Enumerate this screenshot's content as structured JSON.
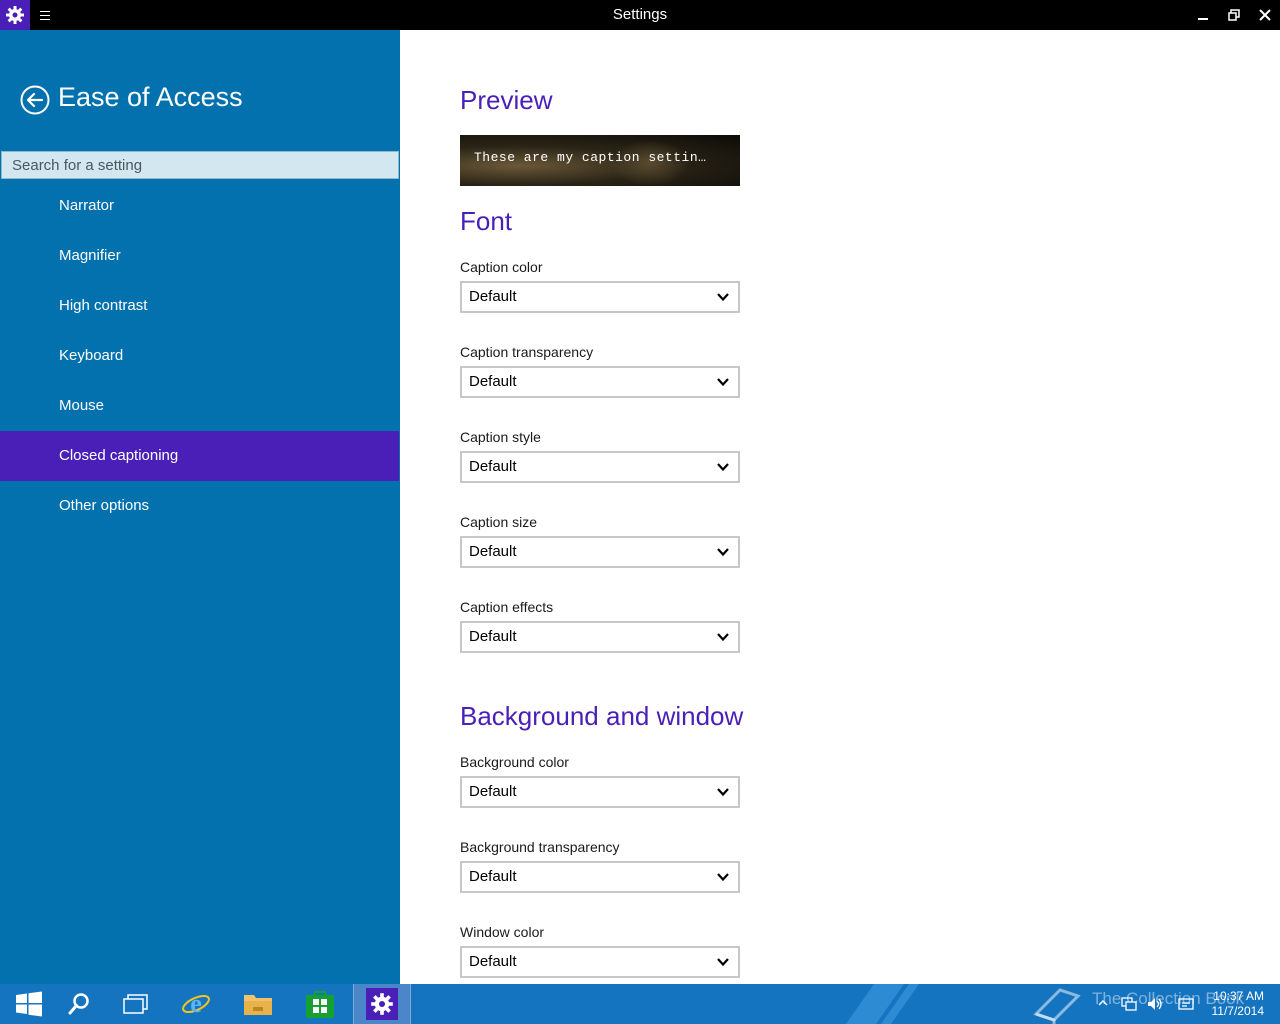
{
  "window": {
    "title": "Settings"
  },
  "sidebar": {
    "title": "Ease of Access",
    "search_placeholder": "Search for a setting",
    "items": [
      {
        "label": "Narrator"
      },
      {
        "label": "Magnifier"
      },
      {
        "label": "High contrast"
      },
      {
        "label": "Keyboard"
      },
      {
        "label": "Mouse"
      },
      {
        "label": "Closed captioning",
        "active": true
      },
      {
        "label": "Other options"
      }
    ]
  },
  "main": {
    "preview_heading": "Preview",
    "preview_text": "These are my caption settin…",
    "font_heading": "Font",
    "font_fields": [
      {
        "label": "Caption color",
        "value": "Default"
      },
      {
        "label": "Caption transparency",
        "value": "Default"
      },
      {
        "label": "Caption style",
        "value": "Default"
      },
      {
        "label": "Caption size",
        "value": "Default"
      },
      {
        "label": "Caption effects",
        "value": "Default"
      }
    ],
    "background_heading": "Background and window",
    "background_fields": [
      {
        "label": "Background color",
        "value": "Default"
      },
      {
        "label": "Background transparency",
        "value": "Default"
      },
      {
        "label": "Window color",
        "value": "Default"
      }
    ]
  },
  "taskbar": {
    "time": "10:37 AM",
    "date": "11/7/2014",
    "watermark": "The Collection Book"
  },
  "colors": {
    "sidebar_bg": "#0271ae",
    "accent": "#4a1fb8",
    "taskbar_bg": "#1574c0"
  }
}
